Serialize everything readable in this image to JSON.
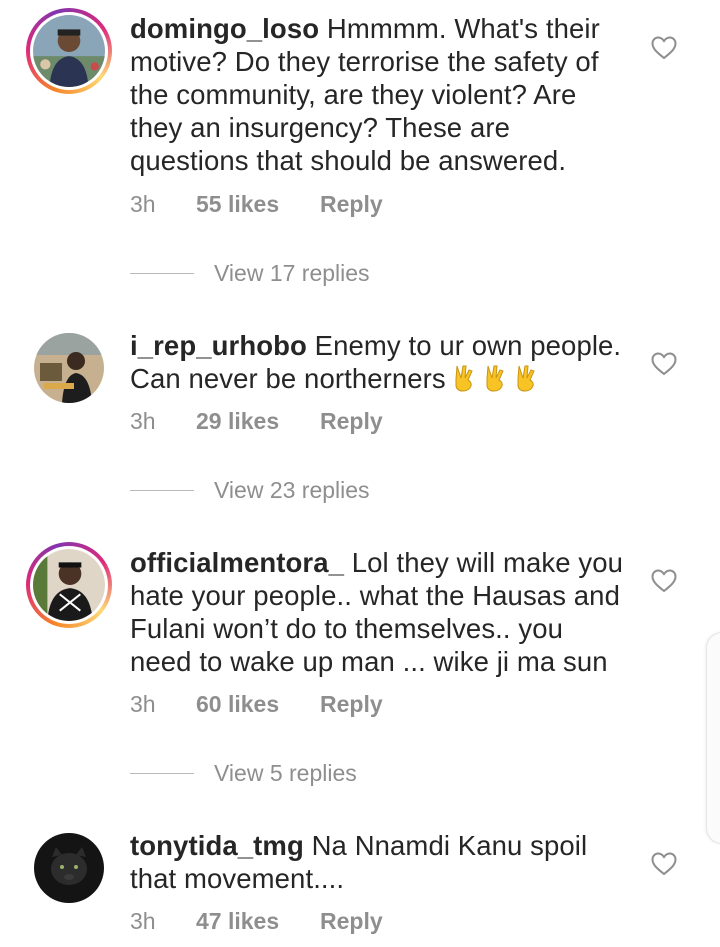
{
  "comments": [
    {
      "username": "domingo_loso",
      "text": "Hmmmm. What's their motive? Do they terrorise the safety of the community, are they violent? Are they an insurgency? These are questions that should be answered.",
      "time": "3h",
      "likes": "55 likes",
      "reply": "Reply",
      "view_replies": "View 17 replies",
      "has_story_ring": true
    },
    {
      "username": "i_rep_urhobo",
      "text": "Enemy to ur own people. Can never be northerners",
      "emoji": "victory-hand-icon x3",
      "time": "3h",
      "likes": "29 likes",
      "reply": "Reply",
      "view_replies": "View 23 replies",
      "has_story_ring": false
    },
    {
      "username": "officialmentora_",
      "text": "Lol they will make you hate your people.. what  the Hausas and Fulani won’t do to themselves.. you need to wake up man ... wike ji ma sun",
      "time": "3h",
      "likes": "60 likes",
      "reply": "Reply",
      "view_replies": "View 5 replies",
      "has_story_ring": true
    },
    {
      "username": "tonytida_tmg",
      "text": "Na Nnamdi Kanu spoil that movement....",
      "time": "3h",
      "likes": "47 likes",
      "reply": "Reply",
      "has_story_ring": false
    }
  ],
  "colors": {
    "text": "#262626",
    "meta": "#8e8e8e",
    "divider": "#b9b9b9",
    "heart_outline": "#8e8e8e",
    "emoji": "#f7c325"
  },
  "icons": {
    "like": "heart-outline-icon",
    "emoji": "victory-hand-icon"
  }
}
